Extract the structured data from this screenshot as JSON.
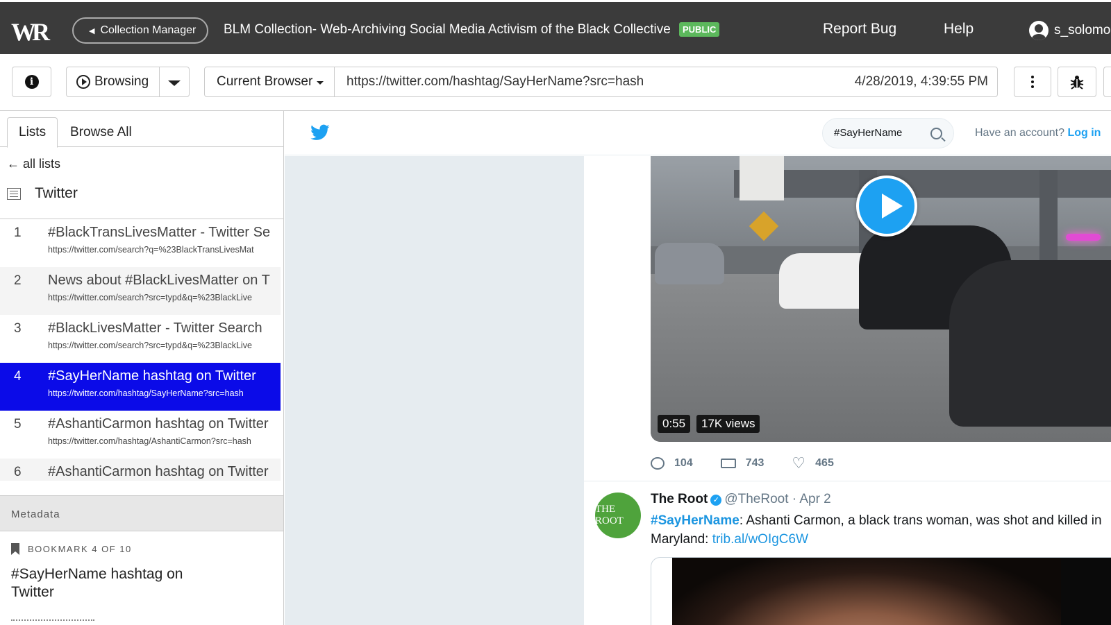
{
  "topbar": {
    "logo": "WR",
    "collection_manager": "Collection Manager",
    "collection_title": "BLM Collection- Web-Archiving Social Media Activism of the Black Collective",
    "badge": "PUBLIC",
    "report_bug": "Report Bug",
    "help": "Help",
    "username": "s_solomo"
  },
  "toolbar": {
    "mode_label": "Browsing",
    "browser_label": "Current Browser",
    "url": "https://twitter.com/hashtag/SayHerName?src=hash",
    "timestamp": "4/28/2019, 4:39:55 PM"
  },
  "sidebar": {
    "tabs": [
      "Lists",
      "Browse All"
    ],
    "back_link": "all lists",
    "list_title": "Twitter",
    "items": [
      {
        "num": "1",
        "title": "#BlackTransLivesMatter - Twitter Se",
        "url": "https://twitter.com/search?q=%23BlackTransLivesMat"
      },
      {
        "num": "2",
        "title": "News about #BlackLivesMatter on T",
        "url": "https://twitter.com/search?src=typd&q=%23BlackLive"
      },
      {
        "num": "3",
        "title": "#BlackLivesMatter - Twitter Search",
        "url": "https://twitter.com/search?src=typd&q=%23BlackLive"
      },
      {
        "num": "4",
        "title": "#SayHerName hashtag on Twitter",
        "url": "https://twitter.com/hashtag/SayHerName?src=hash"
      },
      {
        "num": "5",
        "title": "#AshantiCarmon hashtag on Twitter",
        "url": "https://twitter.com/hashtag/AshantiCarmon?src=hash"
      },
      {
        "num": "6",
        "title": "#AshantiCarmon hashtag on Twitter",
        "url": ""
      }
    ],
    "selected_index": 3,
    "metadata_label": "Metadata",
    "bookmark_label": "BOOKMARK 4 OF 10",
    "bookmark_title": "#SayHerName hashtag on Twitter"
  },
  "twitter": {
    "search_value": "#SayHerName",
    "account_prompt": "Have an account?",
    "login": "Log in",
    "video_duration": "0:55",
    "video_views": "17K views",
    "replies": "104",
    "retweets": "743",
    "likes": "465",
    "tweet": {
      "name": "The Root",
      "avatar_text": "THE ROOT",
      "handle": "@TheRoot",
      "date": "· Apr 2",
      "hashtag": "#SayHerName",
      "text": ": Ashanti Carmon, a black trans woman, was shot and killed in Maryland: ",
      "link": "trib.al/wOIgC6W"
    }
  },
  "colors": {
    "topbar_bg": "#3b3b3b",
    "public_badge": "#5cb85c",
    "selected_item": "#0b0be8",
    "twitter_blue": "#1da1f2",
    "root_green": "#4fa33c"
  }
}
